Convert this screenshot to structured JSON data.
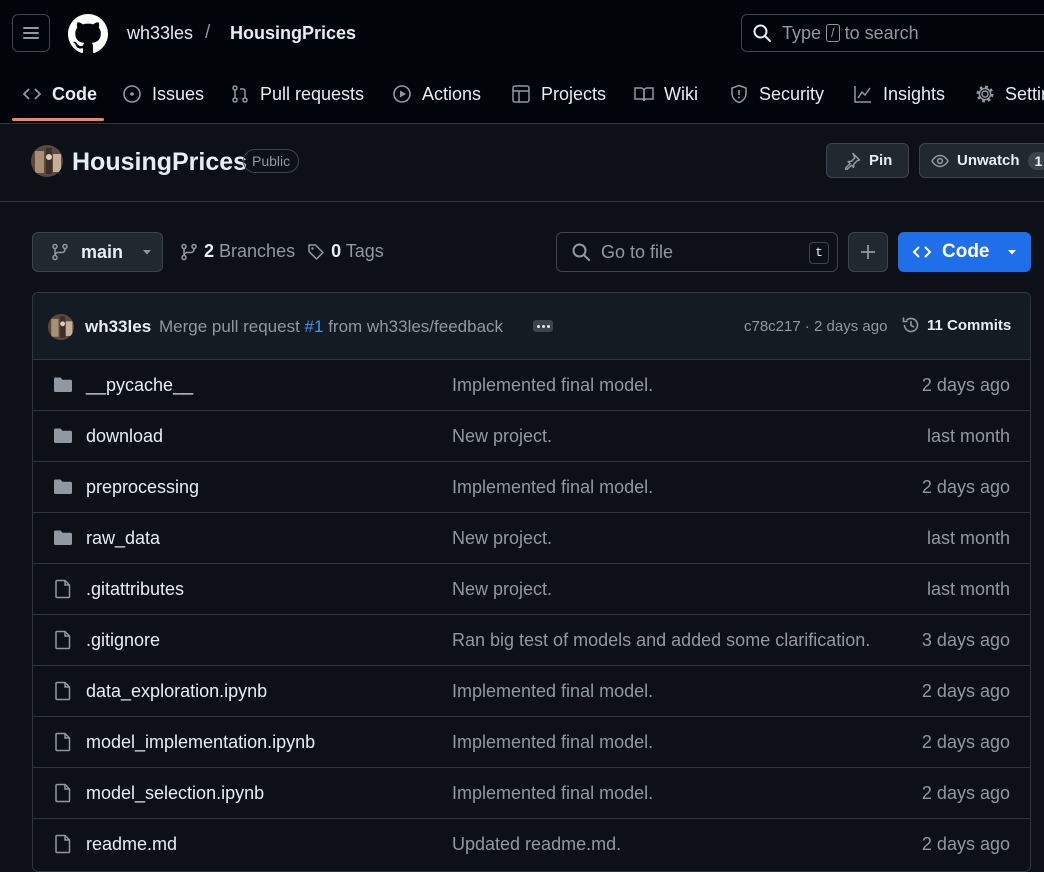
{
  "nav": {
    "owner": "wh33les",
    "separator": "/",
    "repo": "HousingPrices",
    "search_prefix": "Type",
    "search_key": "/",
    "search_suffix": "to search"
  },
  "tabs": [
    {
      "label": "Code",
      "icon": "code-icon"
    },
    {
      "label": "Issues",
      "icon": "issue-icon"
    },
    {
      "label": "Pull requests",
      "icon": "pull-request-icon"
    },
    {
      "label": "Actions",
      "icon": "play-icon"
    },
    {
      "label": "Projects",
      "icon": "table-icon"
    },
    {
      "label": "Wiki",
      "icon": "book-icon"
    },
    {
      "label": "Security",
      "icon": "shield-icon"
    },
    {
      "label": "Insights",
      "icon": "graph-icon"
    },
    {
      "label": "Settings",
      "icon": "gear-icon"
    }
  ],
  "repo_header": {
    "title": "HousingPrices",
    "visibility": "Public",
    "pin_label": "Pin",
    "watch_label": "Unwatch",
    "watch_count": "1"
  },
  "toolbar": {
    "branch": "main",
    "branches_count": "2",
    "branches_label": "Branches",
    "tags_count": "0",
    "tags_label": "Tags",
    "goto_placeholder": "Go to file",
    "goto_key": "t",
    "code_label": "Code"
  },
  "latest_commit": {
    "author": "wh33les",
    "message_prefix": "Merge pull request",
    "pr_ref": "#1",
    "message_suffix": "from wh33les/feedback",
    "meta": "c78c217 · 2 days ago",
    "commits_label": "11 Commits"
  },
  "files": [
    {
      "name": "__pycache__",
      "type": "dir",
      "message": "Implemented final model.",
      "date": "2 days ago"
    },
    {
      "name": "download",
      "type": "dir",
      "message": "New project.",
      "date": "last month"
    },
    {
      "name": "preprocessing",
      "type": "dir",
      "message": "Implemented final model.",
      "date": "2 days ago"
    },
    {
      "name": "raw_data",
      "type": "dir",
      "message": "New project.",
      "date": "last month"
    },
    {
      "name": ".gitattributes",
      "type": "file",
      "message": "New project.",
      "date": "last month"
    },
    {
      "name": ".gitignore",
      "type": "file",
      "message": "Ran big test of models and added some clarification.",
      "date": "3 days ago"
    },
    {
      "name": "data_exploration.ipynb",
      "type": "file",
      "message": "Implemented final model.",
      "date": "2 days ago"
    },
    {
      "name": "model_implementation.ipynb",
      "type": "file",
      "message": "Implemented final model.",
      "date": "2 days ago"
    },
    {
      "name": "model_selection.ipynb",
      "type": "file",
      "message": "Implemented final model.",
      "date": "2 days ago"
    },
    {
      "name": "readme.md",
      "type": "file",
      "message": "Updated readme.md.",
      "date": "2 days ago"
    }
  ],
  "colors": {
    "background": "#0d1117",
    "header": "#010409",
    "accent_blue": "#1f6feb",
    "tab_underline": "#f78166",
    "muted_text": "#9198a1"
  }
}
